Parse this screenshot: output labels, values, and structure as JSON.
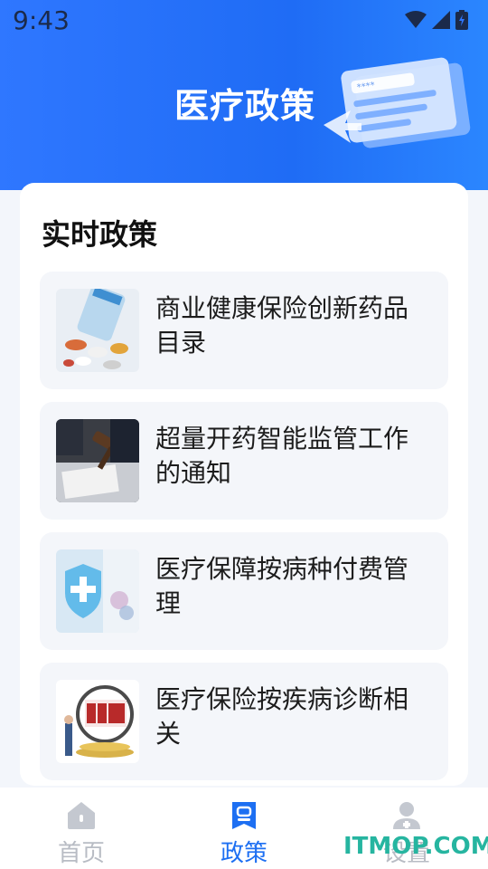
{
  "status_bar": {
    "time": "9:43"
  },
  "header": {
    "title": "医疗政策"
  },
  "panel": {
    "title": "实时政策",
    "items": [
      {
        "title": "商业健康保险创新药品目录"
      },
      {
        "title": "超量开药智能监管工作的通知"
      },
      {
        "title": "医疗保障按病种付费管理"
      },
      {
        "title": "医疗保险按疾病诊断相关"
      }
    ]
  },
  "tabbar": {
    "tabs": [
      {
        "label": "首页",
        "icon": "home-icon",
        "active": false
      },
      {
        "label": "政策",
        "icon": "policy-icon",
        "active": true
      },
      {
        "label": "设置",
        "icon": "user-settings-icon",
        "active": false
      }
    ]
  },
  "watermark": "ITMOP.COM",
  "colors": {
    "accent": "#1d6ff2",
    "header_blue": "#2f77ff",
    "card_bg": "#f4f6fa"
  }
}
